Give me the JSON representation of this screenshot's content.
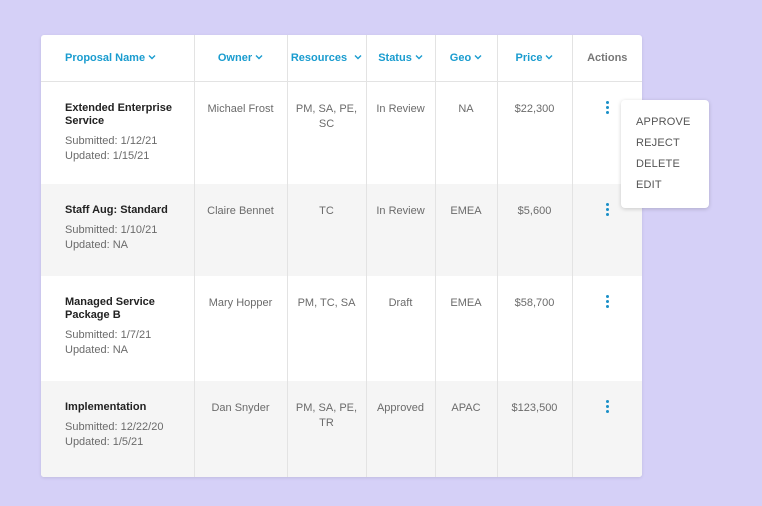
{
  "table": {
    "columns": [
      {
        "label": "Proposal Name",
        "sortable": true
      },
      {
        "label": "Owner",
        "sortable": true
      },
      {
        "label": "Resources",
        "sortable": true
      },
      {
        "label": "Status",
        "sortable": true
      },
      {
        "label": "Geo",
        "sortable": true
      },
      {
        "label": "Price",
        "sortable": true
      },
      {
        "label": "Actions",
        "sortable": false
      }
    ],
    "rows": [
      {
        "name": "Extended Enterprise Service",
        "submitted": "Submitted: 1/12/21",
        "updated": "Updated: 1/15/21",
        "owner": "Michael Frost",
        "resources": "PM, SA, PE, SC",
        "status": "In Review",
        "geo": "NA",
        "price": "$22,300"
      },
      {
        "name": "Staff Aug: Standard",
        "submitted": "Submitted: 1/10/21",
        "updated": "Updated: NA",
        "owner": "Claire Bennet",
        "resources": "TC",
        "status": "In Review",
        "geo": "EMEA",
        "price": "$5,600"
      },
      {
        "name": "Managed Service Package B",
        "submitted": "Submitted: 1/7/21",
        "updated": "Updated: NA",
        "owner": "Mary Hopper",
        "resources": "PM, TC, SA",
        "status": "Draft",
        "geo": "EMEA",
        "price": "$58,700"
      },
      {
        "name": "Implementation",
        "submitted": "Submitted: 12/22/20",
        "updated": "Updated: 1/5/21",
        "owner": "Dan Snyder",
        "resources": "PM, SA, PE, TR",
        "status": "Approved",
        "geo": "APAC",
        "price": "$123,500"
      }
    ]
  },
  "action_menu": {
    "items": [
      "APPROVE",
      "REJECT",
      "DELETE",
      "EDIT"
    ]
  },
  "colors": {
    "background": "#d5d0f7",
    "header_accent": "#1a9ccf",
    "kebab": "#1a8fc7",
    "row_alt": "#f5f5f5"
  },
  "icons": {
    "sort": "chevron-down-icon",
    "row_action": "kebab-menu-icon"
  }
}
